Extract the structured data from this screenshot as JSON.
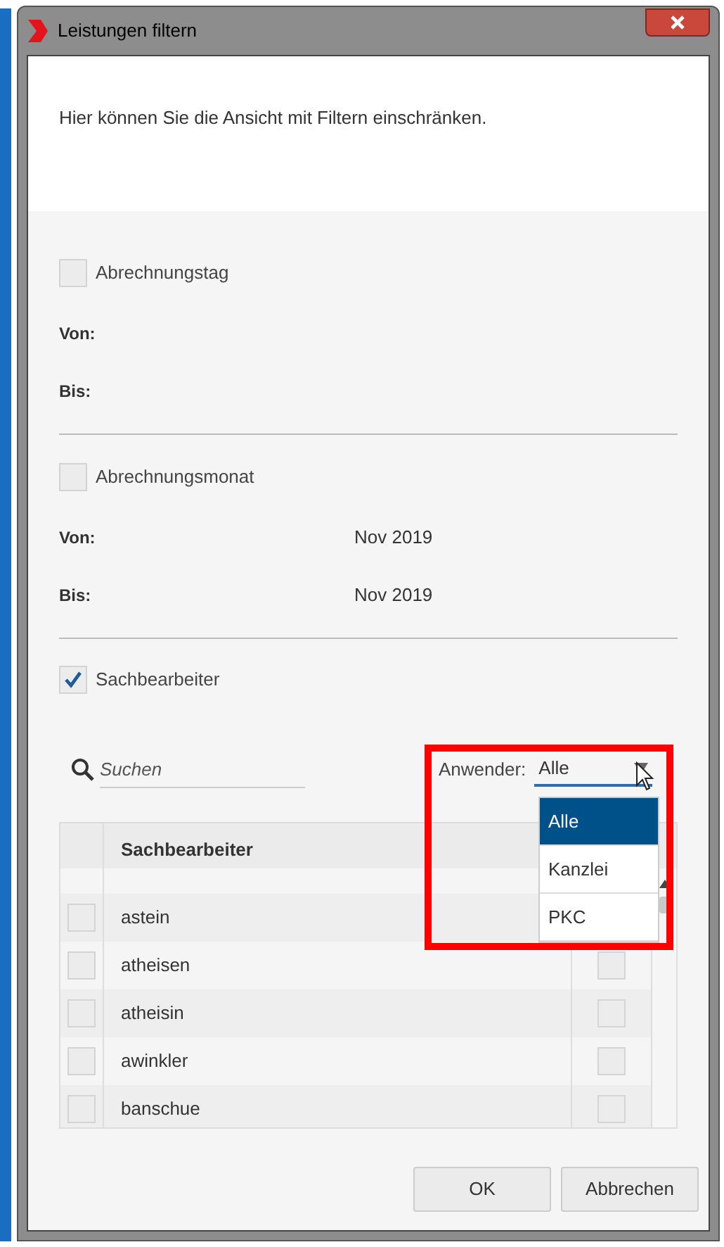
{
  "window": {
    "title": "Leistungen filtern"
  },
  "intro": "Hier können Sie die Ansicht mit Filtern einschränken.",
  "sections": [
    {
      "label": "Abrechnungstag",
      "checked": false,
      "fields": [
        {
          "label": "Von:"
        },
        {
          "label": "Bis:"
        }
      ]
    },
    {
      "label": "Abrechnungsmonat",
      "checked": false,
      "fields": [
        {
          "label": "Von:",
          "value": "Nov 2019"
        },
        {
          "label": "Bis:",
          "value": "Nov 2019"
        }
      ]
    }
  ],
  "staff": {
    "label": "Sachbearbeiter",
    "checked": true,
    "search": {
      "placeholder": "Suchen"
    },
    "user_filter": {
      "label": "Anwender:",
      "value": "Alle",
      "expanded": true,
      "options": [
        {
          "label": "Alle",
          "selected": true
        },
        {
          "label": "Kanzlei",
          "selected": false
        },
        {
          "label": "PKC",
          "selected": false
        }
      ]
    },
    "table": {
      "column": "Sachbearbeiter",
      "rows": [
        {
          "name": "astein",
          "checked": false
        },
        {
          "name": "atheisen",
          "checked": false,
          "flag": false
        },
        {
          "name": "atheisin",
          "checked": false,
          "flag": false
        },
        {
          "name": "awinkler",
          "checked": false,
          "flag": false
        },
        {
          "name": "banschue",
          "checked": false,
          "flag": false
        }
      ]
    }
  },
  "buttons": [
    "OK",
    "Abbrechen"
  ]
}
